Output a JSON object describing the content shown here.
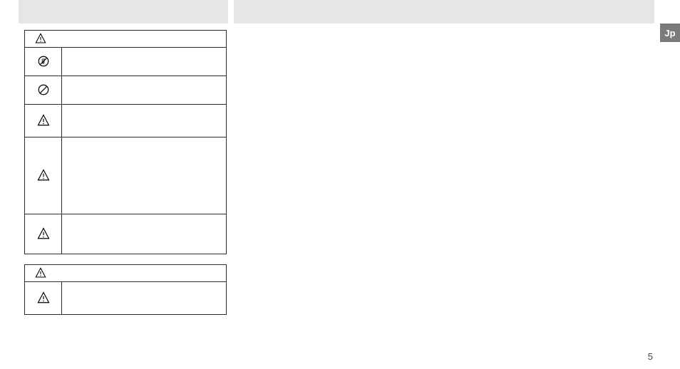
{
  "lang_label": "Jp",
  "page_number": "5",
  "tables": [
    {
      "header_icon": "warning",
      "rows": [
        {
          "icon": "no-touch",
          "height": 40
        },
        {
          "icon": "prohibit",
          "height": 40
        },
        {
          "icon": "warning",
          "height": 46
        },
        {
          "icon": "warning",
          "height": 108
        },
        {
          "icon": "warning",
          "height": 56
        }
      ]
    },
    {
      "header_icon": "warning",
      "rows": [
        {
          "icon": "warning",
          "height": 46
        }
      ]
    }
  ]
}
